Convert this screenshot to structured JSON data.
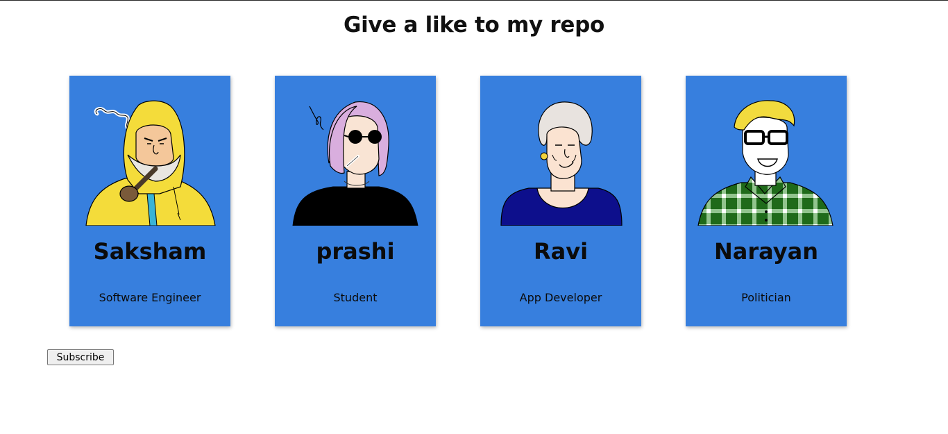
{
  "page": {
    "title": "Give a like to my repo"
  },
  "cards": [
    {
      "name": "Saksham",
      "role": "Software Engineer",
      "avatar_icon": "fisherman-avatar-icon"
    },
    {
      "name": "prashi",
      "role": "Student",
      "avatar_icon": "sunglasses-woman-avatar-icon"
    },
    {
      "name": "Ravi",
      "role": "App Developer",
      "avatar_icon": "grandmother-avatar-icon"
    },
    {
      "name": "Narayan",
      "role": "Politician",
      "avatar_icon": "glasses-man-avatar-icon"
    }
  ],
  "subscribe": {
    "label": "Subscribe"
  },
  "colors": {
    "card": "#377fde",
    "text": "#0b0b0b",
    "background": "#ffffff"
  }
}
